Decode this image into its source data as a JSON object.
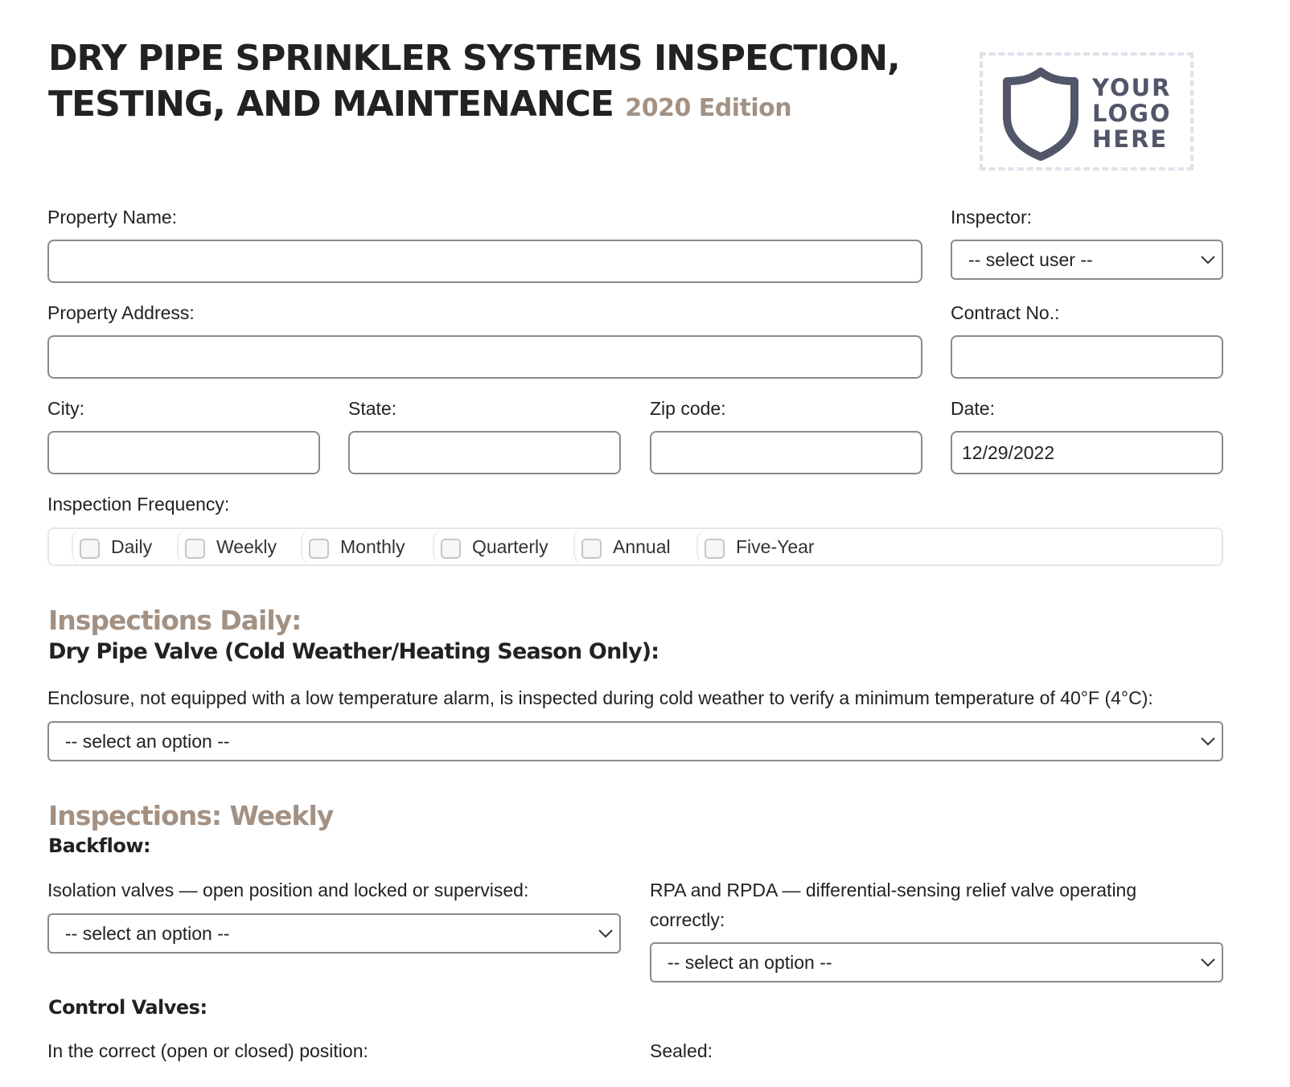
{
  "header": {
    "title_line1": "DRY PIPE SPRINKLER SYSTEMS INSPECTION,",
    "title_line2": "TESTING, AND MAINTENANCE",
    "edition": "2020 Edition",
    "logo": {
      "icon": "shield-icon",
      "lines": [
        "YOUR",
        "LOGO",
        "HERE"
      ]
    }
  },
  "form": {
    "property_name": {
      "label": "Property Name:",
      "value": ""
    },
    "inspector": {
      "label": "Inspector:",
      "selected": "-- select user --"
    },
    "property_address": {
      "label": "Property Address:",
      "value": ""
    },
    "contract_no": {
      "label": "Contract No.:",
      "value": ""
    },
    "city": {
      "label": "City:",
      "value": ""
    },
    "state": {
      "label": "State:",
      "value": ""
    },
    "zip": {
      "label": "Zip code:",
      "value": ""
    },
    "date": {
      "label": "Date:",
      "value": "12/29/2022"
    },
    "frequency": {
      "label": "Inspection Frequency:",
      "options": [
        {
          "label": "Daily",
          "checked": false
        },
        {
          "label": "Weekly",
          "checked": false
        },
        {
          "label": "Monthly",
          "checked": false
        },
        {
          "label": "Quarterly",
          "checked": false
        },
        {
          "label": "Annual",
          "checked": false
        },
        {
          "label": "Five-Year",
          "checked": false
        }
      ]
    }
  },
  "sections": {
    "daily": {
      "heading": "Inspections Daily:",
      "subheading": "Dry Pipe Valve (Cold Weather/Heating Season Only):",
      "q1": {
        "label": "Enclosure, not equipped with a low temperature alarm, is inspected during cold weather to verify a minimum temperature of 40°F (4°C):",
        "selected": "-- select an option --"
      }
    },
    "weekly": {
      "heading": "Inspections: Weekly",
      "backflow": {
        "subheading": "Backflow:",
        "q1": {
          "label": "Isolation valves — open position and locked or supervised:",
          "selected": "-- select an option --"
        },
        "q2": {
          "label_line1": "RPA and RPDA — differential-sensing relief valve operating",
          "label_line2": "correctly:",
          "selected": "-- select an option --"
        }
      },
      "control_valves": {
        "subheading": "Control Valves:",
        "q1": {
          "label": "In the correct (open or closed) position:"
        },
        "q2": {
          "label": "Sealed:"
        }
      }
    }
  }
}
